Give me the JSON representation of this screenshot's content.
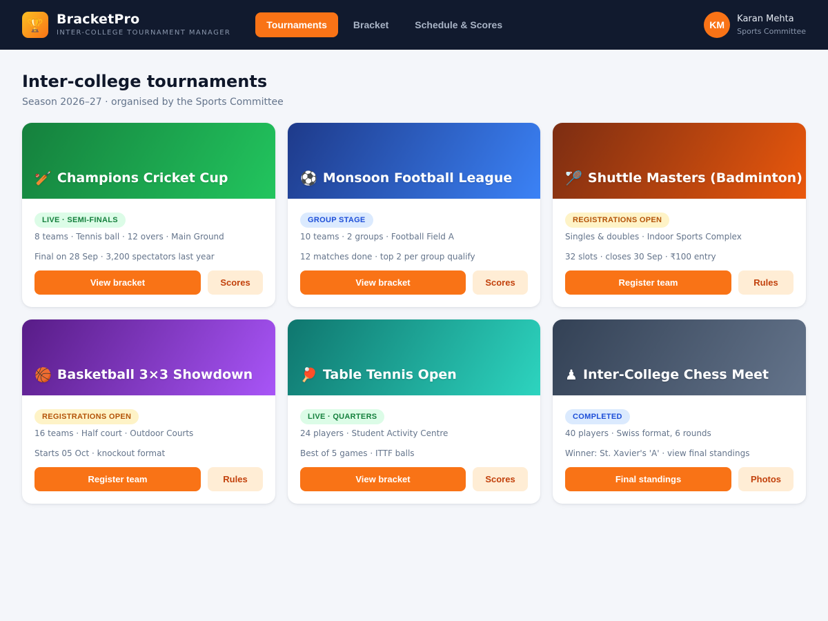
{
  "app": {
    "logo_icon": "🏆",
    "name": "BracketPro",
    "subtitle": "INTER-COLLEGE TOURNAMENT MANAGER"
  },
  "nav": {
    "items": [
      {
        "label": "Tournaments",
        "active": true
      },
      {
        "label": "Bracket",
        "active": false
      },
      {
        "label": "Schedule & Scores",
        "active": false
      }
    ]
  },
  "user": {
    "initials": "KM",
    "name": "Karan Mehta",
    "role": "Sports Committee"
  },
  "page": {
    "title": "Inter-college tournaments",
    "subtitle": "Season 2026–27 · organised by the Sports Committee"
  },
  "cards": [
    {
      "icon": "🏏",
      "icon_name": "cricket-icon",
      "title": "Champions Cricket Cup",
      "badge": "LIVE · SEMI-FINALS",
      "badge_type": "live",
      "meta": "8 teams · Tennis ball · 12 overs · Main Ground",
      "detail": "Final on 28 Sep · 3,200 spectators last year",
      "primary": "View bracket",
      "secondary": "Scores",
      "gradient": [
        "#15803d",
        "#22c55e"
      ]
    },
    {
      "icon": "⚽",
      "icon_name": "football-icon",
      "title": "Monsoon Football League",
      "badge": "GROUP STAGE",
      "badge_type": "group",
      "meta": "10 teams · 2 groups · Football Field A",
      "detail": "12 matches done · top 2 per group qualify",
      "primary": "View bracket",
      "secondary": "Scores",
      "gradient": [
        "#1e3a8a",
        "#3b82f6"
      ]
    },
    {
      "icon": "🏸",
      "icon_name": "badminton-icon",
      "title": "Shuttle Masters (Badminton)",
      "badge": "REGISTRATIONS OPEN",
      "badge_type": "reg",
      "meta": "Singles & doubles · Indoor Sports Complex",
      "detail": "32 slots · closes 30 Sep · ₹100 entry",
      "primary": "Register team",
      "secondary": "Rules",
      "gradient": [
        "#7c2d12",
        "#ea580c"
      ]
    },
    {
      "icon": "🏀",
      "icon_name": "basketball-icon",
      "title": "Basketball 3×3 Showdown",
      "badge": "REGISTRATIONS OPEN",
      "badge_type": "reg",
      "meta": "16 teams · Half court · Outdoor Courts",
      "detail": "Starts 05 Oct · knockout format",
      "primary": "Register team",
      "secondary": "Rules",
      "gradient": [
        "#581c87",
        "#a855f7"
      ]
    },
    {
      "icon": "🏓",
      "icon_name": "table-tennis-icon",
      "title": "Table Tennis Open",
      "badge": "LIVE · QUARTERS",
      "badge_type": "live",
      "meta": "24 players · Student Activity Centre",
      "detail": "Best of 5 games · ITTF balls",
      "primary": "View bracket",
      "secondary": "Scores",
      "gradient": [
        "#0f766e",
        "#2dd4bf"
      ]
    },
    {
      "icon": "♟",
      "icon_name": "chess-icon",
      "title": "Inter-College Chess Meet",
      "badge": "COMPLETED",
      "badge_type": "done",
      "meta": "40 players · Swiss format, 6 rounds",
      "detail": "Winner: St. Xavier's 'A' · view final standings",
      "primary": "Final standings",
      "secondary": "Photos",
      "gradient": [
        "#334155",
        "#64748b"
      ]
    }
  ]
}
